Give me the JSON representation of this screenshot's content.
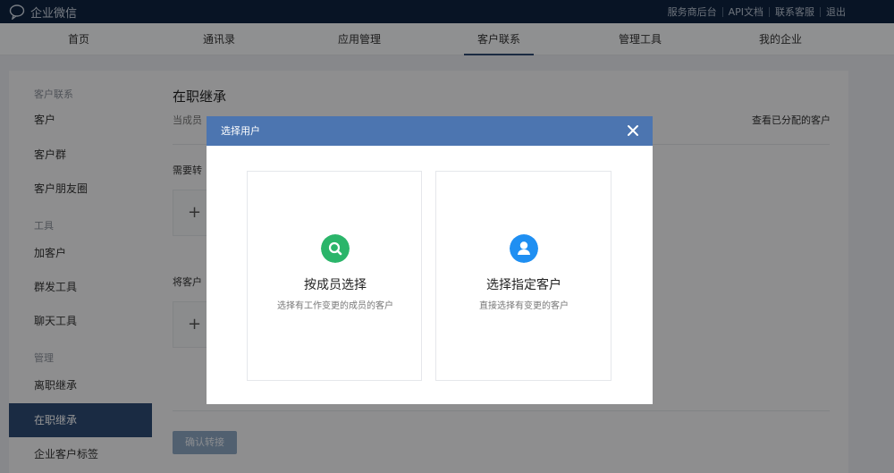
{
  "topbar": {
    "brand": "企业微信",
    "links": [
      "服务商后台",
      "API文档",
      "联系客服",
      "退出"
    ]
  },
  "nav": {
    "items": [
      "首页",
      "通讯录",
      "应用管理",
      "客户联系",
      "管理工具",
      "我的企业"
    ],
    "active": "客户联系"
  },
  "sidebar": {
    "group1": "客户联系",
    "item_customer": "客户",
    "item_group": "客户群",
    "item_moments": "客户朋友圈",
    "group2": "工具",
    "item_add": "加客户",
    "item_broadcast": "群发工具",
    "item_chat": "聊天工具",
    "group3": "管理",
    "item_resigned": "离职继承",
    "item_onjob": "在职继承",
    "item_tags": "企业客户标签"
  },
  "main": {
    "title": "在职继承",
    "desc": "当成员",
    "view_assigned": "查看已分配的客户",
    "section1": "需要转",
    "section2": "将客户",
    "plus": "+",
    "confirm": "确认转接"
  },
  "dialog": {
    "title": "选择用户",
    "close_glyph": "✕",
    "card_member_title": "按成员选择",
    "card_member_sub": "选择有工作变更的成员的客户",
    "card_customer_title": "选择指定客户",
    "card_customer_sub": "直接选择有变更的客户",
    "colors": {
      "header": "#4c75b0",
      "member_icon": "#2bb56a",
      "customer_icon": "#1f8ff2"
    }
  }
}
